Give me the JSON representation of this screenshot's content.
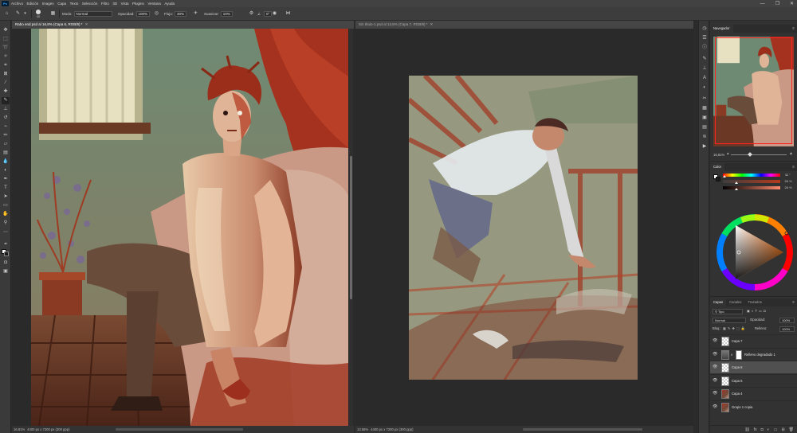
{
  "app": {
    "logo": "Ps",
    "menu": [
      "Archivo",
      "Edición",
      "Imagen",
      "Capa",
      "Texto",
      "Selección",
      "Filtro",
      "3D",
      "Vista",
      "Plugins",
      "Ventana",
      "Ayuda"
    ],
    "window_controls": [
      "—",
      "❐",
      "✕"
    ]
  },
  "options_bar": {
    "brush_size": "40",
    "mode_label": "Modo:",
    "mode_value": "Normal",
    "opacity_label": "Opacidad:",
    "opacity_value": "100%",
    "flow_label": "Flujo:",
    "flow_value": "30%",
    "smoothing_label": "Suavizar:",
    "smoothing_value": "10%",
    "angle_value": "0°"
  },
  "documents": [
    {
      "tab_title": "Rabo end.psd al 16,8% (Capa 6, RGB/8) *",
      "zoom": "16.81%",
      "status": "4400 px x 7200 px (300 ppp)"
    },
    {
      "tab_title": "Sin título-1.psd al 13,6% (Capa 7, RGB/8) *",
      "zoom": "13.58%",
      "status": "4400 px x 7200 px (300 ppp)"
    }
  ],
  "navigator": {
    "tab": "Navegador",
    "zoom": "16,81%"
  },
  "color_panel": {
    "tab": "Color",
    "sliders": [
      {
        "label": "H",
        "value": "11",
        "unit": "°",
        "fraction": 0.03
      },
      {
        "label": "S",
        "value": "24",
        "unit": "%",
        "fraction": 0.24
      },
      {
        "label": "B",
        "value": "24",
        "unit": "%",
        "fraction": 0.24
      }
    ],
    "foreground": "#ffffff",
    "background": "#1b1b1b"
  },
  "layers_panel": {
    "tabs": [
      "Capas",
      "Canales",
      "Trazados"
    ],
    "filter_label": "Tipo",
    "blend_mode": "Normal",
    "opacity_label": "Opacidad:",
    "opacity_value": "100%",
    "lock_label": "Bloq.:",
    "fill_label": "Relleno:",
    "fill_value": "100%",
    "layers": [
      {
        "name": "Capa 7",
        "visible": true,
        "selected": false,
        "thumb": "checker"
      },
      {
        "name": "Relleno degradado 1",
        "visible": true,
        "selected": false,
        "thumb": "gradient",
        "has_mask": true
      },
      {
        "name": "Capa 6",
        "visible": true,
        "selected": true,
        "thumb": "checker"
      },
      {
        "name": "Capa 5",
        "visible": true,
        "selected": false,
        "thumb": "checker"
      },
      {
        "name": "Capa 4",
        "visible": true,
        "selected": false,
        "thumb": "art"
      },
      {
        "name": "Grupo 1 copia",
        "visible": true,
        "selected": false,
        "thumb": "art"
      }
    ]
  },
  "colors": {
    "accent_red": "#b8301c",
    "selected_layer": "#505050"
  }
}
